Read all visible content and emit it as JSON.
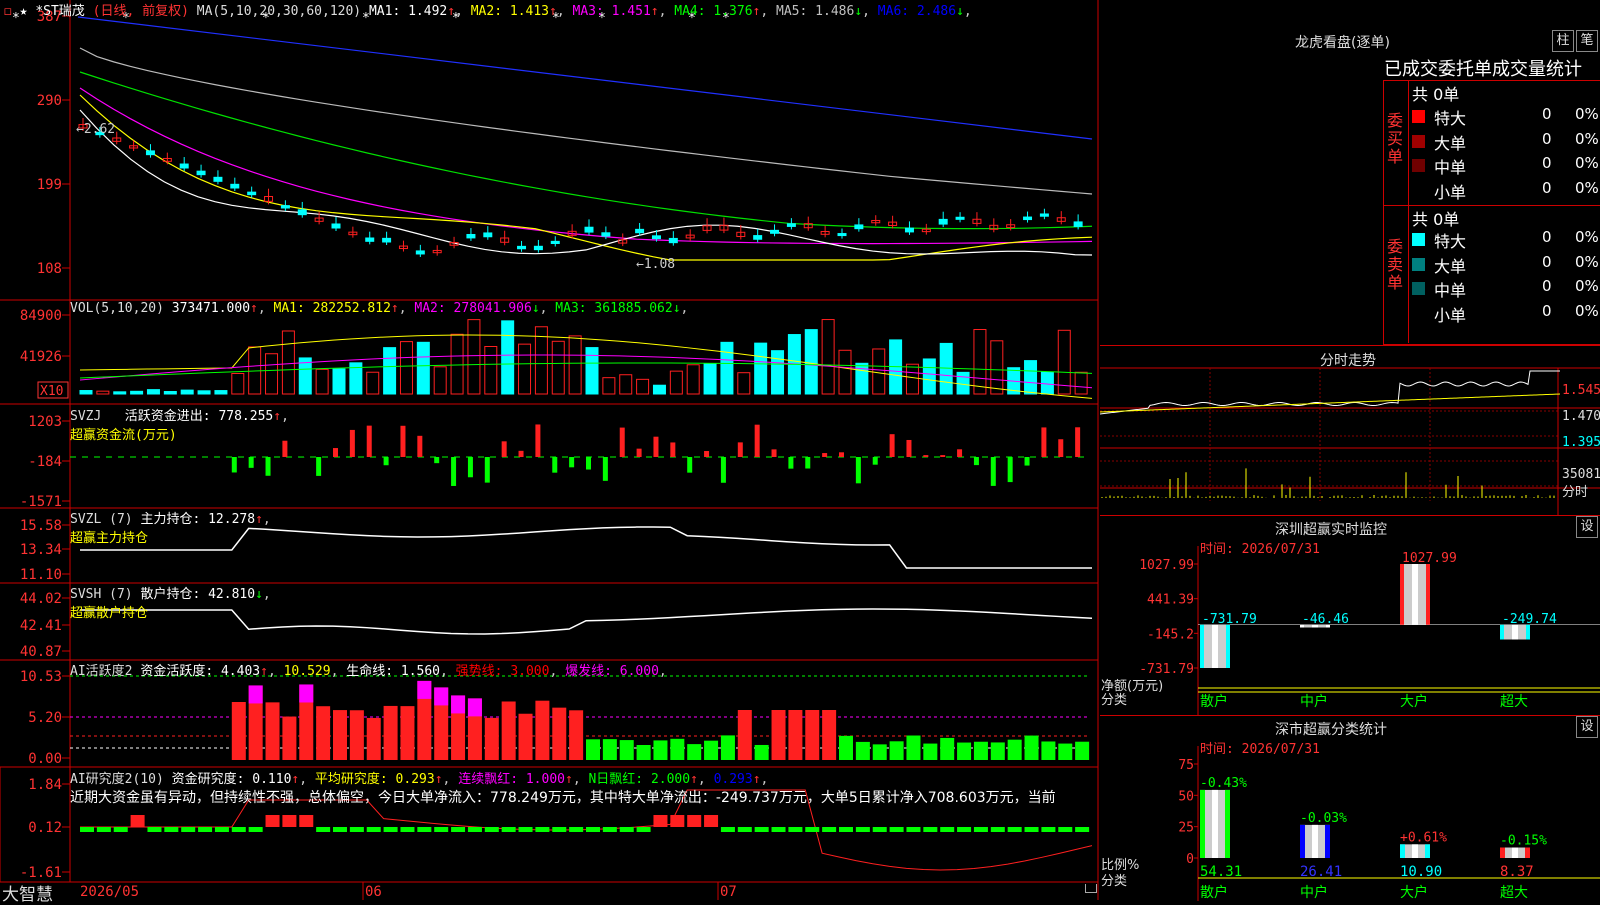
{
  "app": {
    "brand": "大智慧",
    "lock_icon": "lock-icon"
  },
  "header": {
    "prefix": "★",
    "stock": "*ST瑞茂",
    "mode": "(日线, 前复权)",
    "ma_label": "MA(5,10,20,30,60,120)",
    "ma": [
      {
        "label": "MA1: 1.492",
        "arrow": "↑",
        "color": "#ffffff"
      },
      {
        "label": "MA2: 1.413",
        "arrow": "↑",
        "color": "#ffff00"
      },
      {
        "label": "MA3: 1.451",
        "arrow": "↑",
        "color": "#ff00ff"
      },
      {
        "label": "MA4: 1.376",
        "arrow": "↑",
        "color": "#00ff00"
      },
      {
        "label": "MA5: 1.486",
        "arrow": "↓",
        "color": "#c0c0c0"
      },
      {
        "label": "MA6: 2.486",
        "arrow": "↓",
        "color": "#0000ff"
      }
    ]
  },
  "price_panel": {
    "y_ticks": [
      "387",
      "290",
      "199",
      "108"
    ],
    "annot_high": "2.62",
    "annot_low": "1.08"
  },
  "vol_panel": {
    "title": "VOL(5,10,20)",
    "value": "373471.000",
    "ma": [
      {
        "label": "MA1: 282252.812",
        "arrow": "↑",
        "color": "#ffff00"
      },
      {
        "label": "MA2: 278041.906",
        "arrow": "↓",
        "color": "#ff00ff"
      },
      {
        "label": "MA3: 361885.062",
        "arrow": "↓",
        "color": "#00ff00"
      }
    ],
    "y_ticks": [
      "84900",
      "41926"
    ],
    "unit": "X10"
  },
  "svzj_panel": {
    "title": "SVZJ",
    "name": "活跃资金进出: 778.255",
    "arrow": "↑",
    "sub": "超赢资金流(万元)",
    "y_ticks": [
      "1203",
      "-184",
      "-1571"
    ]
  },
  "svzl_panel": {
    "title": "SVZL (7)",
    "name": "主力持仓: 12.278",
    "arrow": "↑",
    "sub": "超赢主力持仓",
    "y_ticks": [
      "15.58",
      "13.34",
      "11.10"
    ]
  },
  "svsh_panel": {
    "title": "SVSH (7)",
    "name": "散户持仓: 42.810",
    "arrow": "↓",
    "sub": "超赢散户持仓",
    "y_ticks": [
      "44.02",
      "42.41",
      "40.87"
    ]
  },
  "ai_active_panel": {
    "title": "AI活跃度2",
    "items": [
      {
        "label": "资金活跃度: 4.403",
        "arrow": "↑",
        "color": "#ffffff"
      },
      {
        "label": "10.529",
        "arrow": "",
        "color": "#ffff00"
      },
      {
        "label": "生命线: 1.560",
        "arrow": "",
        "color": "#ffffff"
      },
      {
        "label": "强势线: 3.000",
        "arrow": "",
        "color": "#ff0000"
      },
      {
        "label": "爆发线: 6.000",
        "arrow": "",
        "color": "#ff00ff"
      }
    ],
    "y_ticks": [
      "10.53",
      "5.20",
      "0.00"
    ]
  },
  "ai_research_panel": {
    "title": "AI研究度2(10)",
    "items": [
      {
        "label": "资金研究度: 0.110",
        "arrow": "↑",
        "color": "#ffffff"
      },
      {
        "label": "平均研究度: 0.293",
        "arrow": "↑",
        "color": "#ffff00"
      },
      {
        "label": "连续飘红: 1.000",
        "arrow": "↑",
        "color": "#ff00ff"
      },
      {
        "label": "N日飘红: 2.000",
        "arrow": "↑",
        "color": "#00ff00"
      },
      {
        "label": "0.293",
        "arrow": "↑",
        "color": "#0000ff"
      }
    ],
    "commentary": "近期大资金虽有异动，但持续性不强，总体偏空，今日大单净流入：778.249万元，其中特大单净流出：-249.737万元，大单5日累计净入708.603万元，当前",
    "y_ticks": [
      "1.84",
      "0.12",
      "-1.61"
    ]
  },
  "x_axis": [
    "2026/05",
    "06",
    "07"
  ],
  "longhu": {
    "title": "龙虎看盘(逐单)",
    "btn1": "柱",
    "btn2": "笔",
    "subtitle": "已成交委托单成交量统计",
    "buy_label": "委买单",
    "sell_label": "委卖单",
    "buy_total": "共 0单",
    "sell_total": "共 0单",
    "buy_rows": [
      {
        "name": "特大",
        "count": "0",
        "pct": "0%",
        "color": "#ff0000"
      },
      {
        "name": "大单",
        "count": "0",
        "pct": "0%",
        "color": "#a00000"
      },
      {
        "name": "中单",
        "count": "0",
        "pct": "0%",
        "color": "#700000"
      },
      {
        "name": "小单",
        "count": "0",
        "pct": "0%",
        "color": "#000000"
      }
    ],
    "sell_rows": [
      {
        "name": "特大",
        "count": "0",
        "pct": "0%",
        "color": "#00ffff"
      },
      {
        "name": "大单",
        "count": "0",
        "pct": "0%",
        "color": "#008080"
      },
      {
        "name": "中单",
        "count": "0",
        "pct": "0%",
        "color": "#006060"
      },
      {
        "name": "小单",
        "count": "0",
        "pct": "0%",
        "color": "#000000"
      }
    ]
  },
  "intraday": {
    "title": "分时走势",
    "ticks": [
      "1.545",
      "1.470",
      "1.395"
    ],
    "vol_tick": "35081",
    "vol_label": "分时"
  },
  "sz_monitor": {
    "title": "深圳超赢实时监控",
    "btn": "设",
    "time": "时间: 2026/07/31",
    "y_ticks": [
      "1027.99",
      "441.39",
      "-145.2",
      "-731.79"
    ],
    "axis_label1": "净额(万元)",
    "axis_label2": "分类",
    "categories": [
      "散户",
      "中户",
      "大户",
      "超大"
    ],
    "bar_labels": [
      "-731.79",
      "-46.46",
      "1027.99",
      "-249.74"
    ]
  },
  "sz_class": {
    "title": "深市超赢分类统计",
    "btn": "设",
    "time": "时间: 2026/07/31",
    "y_ticks": [
      "75",
      "50",
      "25",
      "0"
    ],
    "axis_label1": "比例%",
    "axis_label2": "分类",
    "categories": [
      "散户",
      "中户",
      "大户",
      "超大"
    ],
    "top_labels": [
      "-0.43%",
      "-0.03%",
      "+0.61%",
      "-0.15%"
    ],
    "bottom_labels": [
      "54.31",
      "26.41",
      "10.90",
      "8.37"
    ]
  },
  "chart_data": [
    {
      "type": "bar",
      "title": "深圳超赢实时监控",
      "categories": [
        "散户",
        "中户",
        "大户",
        "超大"
      ],
      "values": [
        -731.79,
        -46.46,
        1027.99,
        -249.74
      ],
      "ylabel": "净额(万元)",
      "ylim": [
        -731.79,
        1027.99
      ]
    },
    {
      "type": "bar",
      "title": "深市超赢分类统计",
      "categories": [
        "散户",
        "中户",
        "大户",
        "超大"
      ],
      "values": [
        54.31,
        26.41,
        10.9,
        8.37
      ],
      "changes": [
        "-0.43%",
        "-0.03%",
        "+0.61%",
        "-0.15%"
      ],
      "ylabel": "比例%",
      "ylim": [
        0,
        75
      ]
    }
  ]
}
